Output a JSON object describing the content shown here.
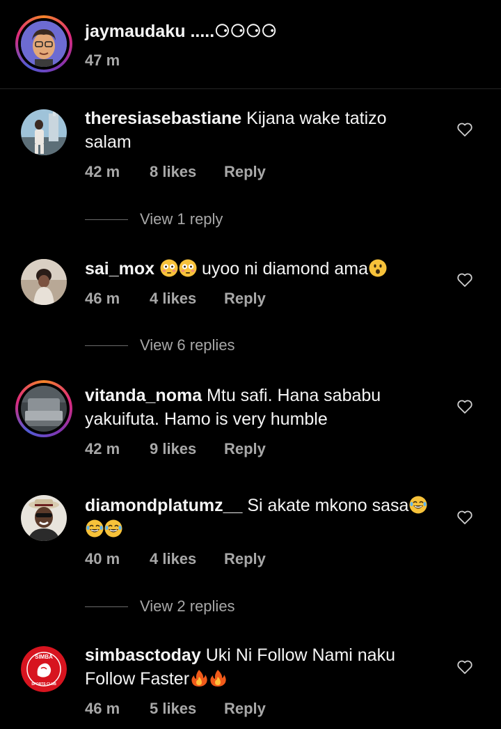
{
  "caption": {
    "username": "jaymaudaku",
    "text": " .....⚆⚆⚆⚆",
    "time": "47 m"
  },
  "comments": [
    {
      "username": "theresiasebastiane",
      "text": " Kijana wake tatizo salam",
      "time": "42 m",
      "likes": "8 likes",
      "reply": "Reply",
      "view_replies": "View 1 reply"
    },
    {
      "username": "sai_mox",
      "text": " uyoo ni diamond ama",
      "time": "46 m",
      "likes": "4 likes",
      "reply": "Reply",
      "view_replies": "View 6 replies"
    },
    {
      "username": "vitanda_noma",
      "text": " Mtu safi. Hana sababu yakuifuta. Hamo is very humble",
      "time": "42 m",
      "likes": "9 likes",
      "reply": "Reply"
    },
    {
      "username": "diamondplatumz__",
      "text": " Si akate mkono sasa",
      "time": "40 m",
      "likes": "4 likes",
      "reply": "Reply",
      "view_replies": "View 2 replies"
    },
    {
      "username": "simbasctoday",
      "text": " Uki Ni Follow Nami naku Follow Faster",
      "time": "46 m",
      "likes": "5 likes",
      "reply": "Reply"
    }
  ],
  "icons": {
    "heart": "heart-outline-icon",
    "flushed_emoji": "flushed-face-emoji",
    "surprised_emoji": "hushed-face-emoji",
    "laughing_emoji": "tears-of-joy-emoji",
    "fire_emoji": "fire-emoji"
  },
  "colors": {
    "background": "#000000",
    "text": "#f5f5f5",
    "secondary": "#a8a8a8"
  }
}
